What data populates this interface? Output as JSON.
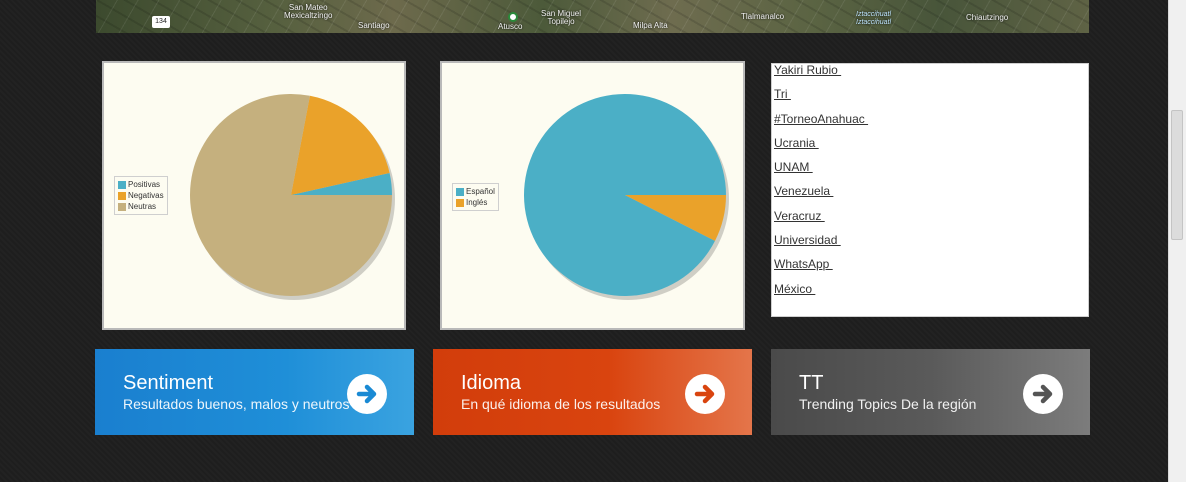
{
  "map": {
    "labels": [
      {
        "text": "134",
        "kind": "shield"
      },
      {
        "text": "San Mateo\nMexicaltzingo",
        "kind": "town"
      },
      {
        "text": "Santiago",
        "kind": "town"
      },
      {
        "text": "Atusco",
        "kind": "town"
      },
      {
        "text": "San Miguel\nTopilejo",
        "kind": "town"
      },
      {
        "text": "Milpa Alta",
        "kind": "town"
      },
      {
        "text": "Tlalmanalco",
        "kind": "town"
      },
      {
        "text": "Iztaccihuatl\nIztaccihuatl",
        "kind": "peak"
      },
      {
        "text": "Chiautzingo",
        "kind": "town"
      }
    ]
  },
  "charts": [
    {
      "id": "sentiment-chart",
      "chart_data": {
        "type": "pie",
        "labels": [
          "Positivas",
          "Negativas",
          "Neutras"
        ],
        "values": [
          3.5,
          18.5,
          78
        ],
        "colors": [
          "#4bafc6",
          "#eaa22a",
          "#c5b07e"
        ],
        "legend_position": "left"
      }
    },
    {
      "id": "language-chart",
      "chart_data": {
        "type": "pie",
        "labels": [
          "Español",
          "Inglés"
        ],
        "values": [
          92.5,
          7.5
        ],
        "colors": [
          "#4bafc6",
          "#eaa22a"
        ],
        "legend_position": "left"
      }
    }
  ],
  "trending_topics": [
    "Yakiri Rubio ",
    "Tri ",
    "#TorneoAnahuac ",
    "Ucrania ",
    "UNAM ",
    "Venezuela ",
    "Veracruz ",
    "Universidad ",
    "WhatsApp ",
    "México "
  ],
  "tiles": [
    {
      "title": "Sentiment",
      "subtitle": "Resultados buenos, malos y neutros",
      "color": "#1a8ad4",
      "icon": "arrow-right-icon"
    },
    {
      "title": "Idioma",
      "subtitle": "En qué idioma de los resultados",
      "color": "#d9440f",
      "icon": "arrow-right-icon"
    },
    {
      "title": "TT",
      "subtitle": "Trending Topics De la región",
      "color": "#5a5a5a",
      "icon": "arrow-right-icon"
    }
  ]
}
